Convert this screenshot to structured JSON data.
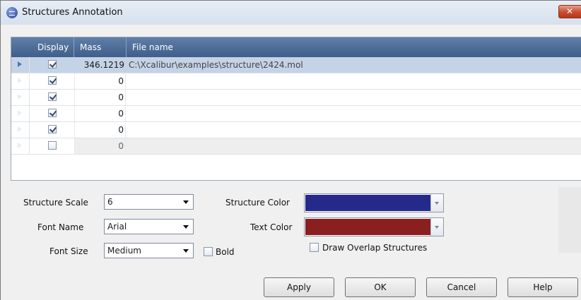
{
  "window": {
    "title": "Structures Annotation",
    "close_label": "✕"
  },
  "grid": {
    "headers": {
      "display": "Display",
      "mass": "Mass",
      "file": "File name"
    },
    "rows": [
      {
        "checked": true,
        "mass": "346.1219",
        "file": "C:\\Xcalibur\\examples\\structure\\2424.mol"
      },
      {
        "checked": true,
        "mass": "0",
        "file": ""
      },
      {
        "checked": true,
        "mass": "0",
        "file": ""
      },
      {
        "checked": true,
        "mass": "0",
        "file": ""
      },
      {
        "checked": true,
        "mass": "0",
        "file": ""
      },
      {
        "checked": false,
        "mass": "0",
        "file": ""
      }
    ]
  },
  "settings": {
    "structure_scale_label": "Structure Scale",
    "structure_scale_value": "6",
    "font_name_label": "Font Name",
    "font_name_value": "Arial",
    "font_size_label": "Font Size",
    "font_size_value": "Medium",
    "bold_label": "Bold",
    "bold_checked": false,
    "structure_color_label": "Structure Color",
    "structure_color": "#252a8a",
    "text_color_label": "Text Color",
    "text_color": "#8a1f1f",
    "draw_overlap_label": "Draw Overlap Structures",
    "draw_overlap_checked": false
  },
  "buttons": {
    "apply": "Apply",
    "ok": "OK",
    "cancel": "Cancel",
    "help": "Help"
  }
}
